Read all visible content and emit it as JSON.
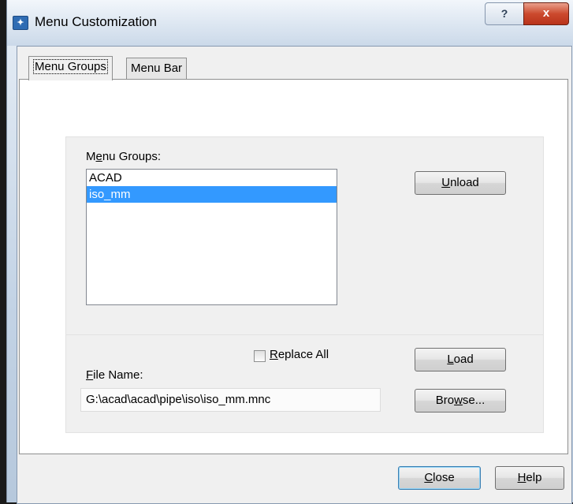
{
  "window": {
    "title": "Menu Customization",
    "help_glyph": "?",
    "close_glyph": "x",
    "icon": "app-icon"
  },
  "tabs": [
    {
      "label": "Menu Groups",
      "active": true
    },
    {
      "label": "Menu Bar",
      "active": false
    }
  ],
  "menu_groups": {
    "label_pre": "M",
    "label_access": "e",
    "label_post": "nu Groups:",
    "items": [
      {
        "label": "ACAD",
        "selected": false
      },
      {
        "label": "iso_mm",
        "selected": true
      }
    ],
    "unload": {
      "access": "U",
      "rest": "nload"
    }
  },
  "file": {
    "replace_all": {
      "access": "R",
      "rest": "eplace All",
      "checked": false
    },
    "load": {
      "access": "L",
      "rest": "oad"
    },
    "file_name_label": {
      "access": "F",
      "rest": "ile Name:"
    },
    "file_name_value": "G:\\acad\\acad\\pipe\\iso\\iso_mm.mnc",
    "browse": {
      "pre": "Bro",
      "access": "w",
      "rest": "se..."
    }
  },
  "footer": {
    "close": {
      "access": "C",
      "rest": "lose"
    },
    "help": {
      "access": "H",
      "rest": "elp"
    }
  },
  "colors": {
    "selection": "#3399ff",
    "close_button": "#cc4a2e",
    "title_bar": "#dce6f1"
  }
}
